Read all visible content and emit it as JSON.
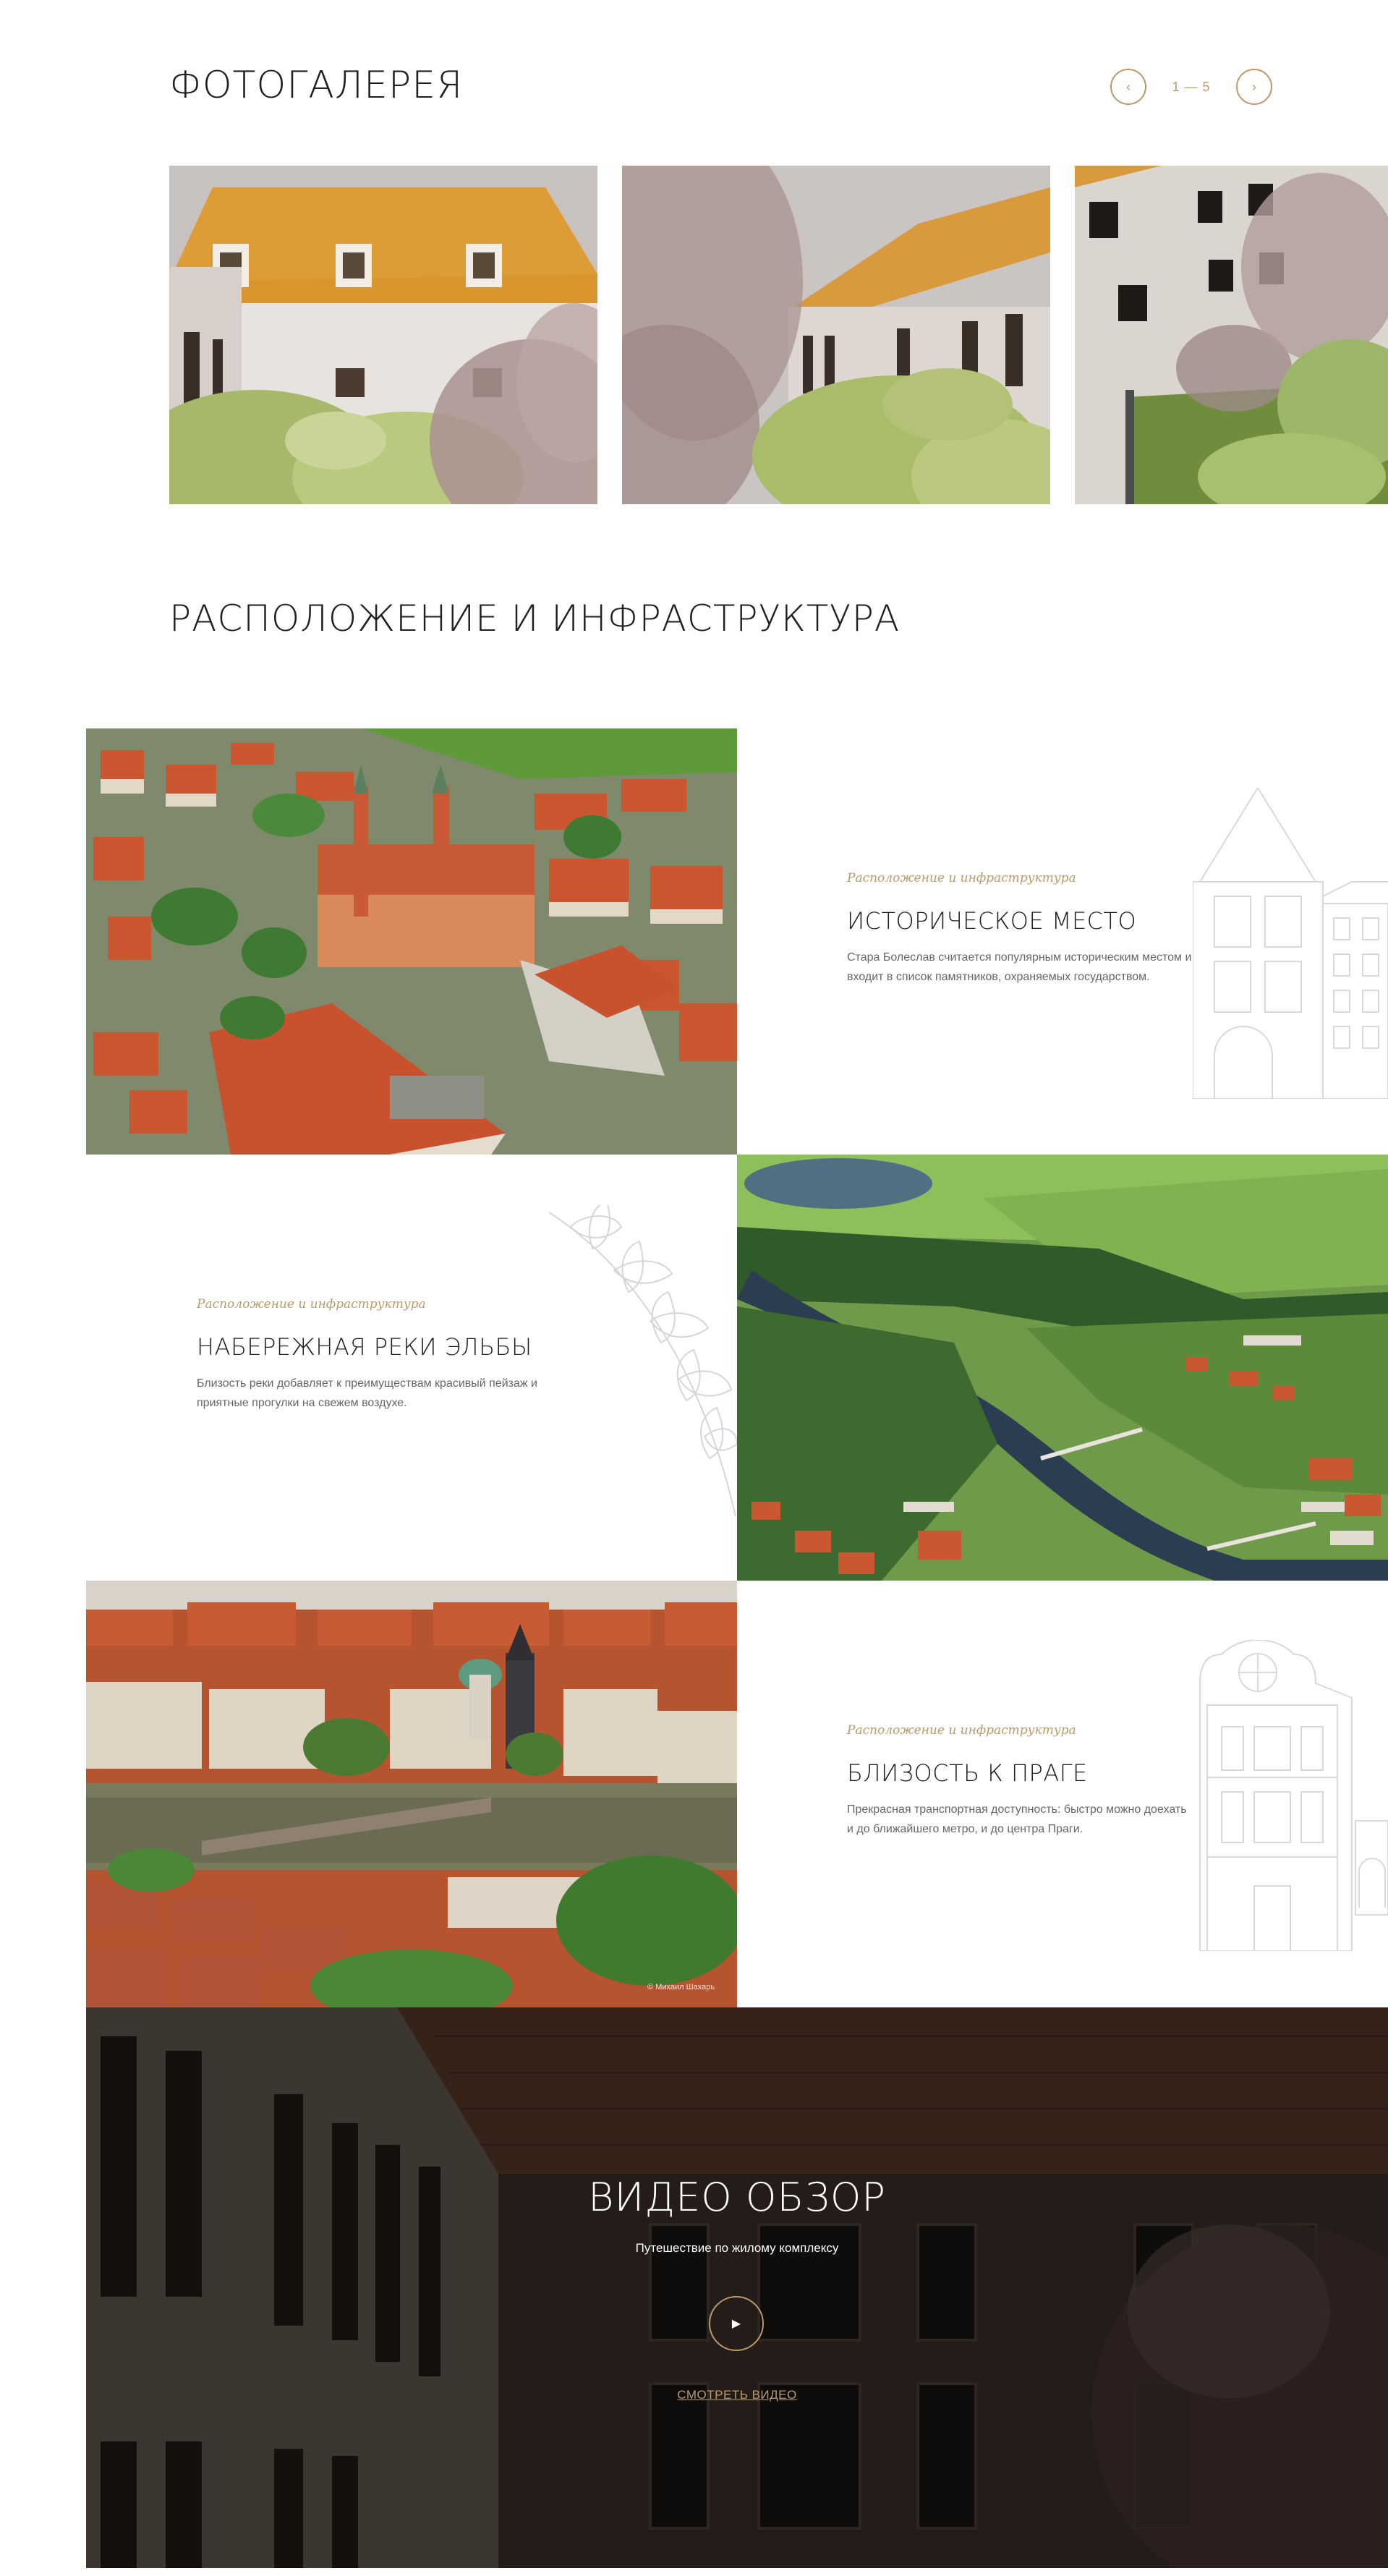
{
  "gallery": {
    "title": "ФОТОГАЛЕРЕЯ",
    "pager_prev_icon": "‹",
    "pager_next_icon": "›",
    "pager_count": "1 — 5"
  },
  "location": {
    "title": "РАСПОЛОЖЕНИЕ И ИНФРАСТРУКТУРА",
    "cards": [
      {
        "kicker": "Расположение и инфраструктура",
        "title": "ИСТОРИЧЕСКОЕ МЕСТО",
        "text_line1": "Стара Болеслав считается популярным историческим местом и",
        "text_line2": "входит в список памятников, охраняемых государством."
      },
      {
        "kicker": "Расположение и инфраструктура",
        "title": "НАБЕРЕЖНАЯ РЕКИ ЭЛЬБЫ",
        "text_line1": "Близость реки добавляет к преимуществам красивый пейзаж и",
        "text_line2": "приятные прогулки на свежем воздухе."
      },
      {
        "kicker": "Расположение и инфраструктура",
        "title": "БЛИЗОСТЬ К ПРАГЕ",
        "text_line1": "Прекрасная транспортная доступность: быстро можно доехать",
        "text_line2": "и до ближайшего метро, и до центра Праги."
      }
    ],
    "photo_credit": "© Михаил Шахарь"
  },
  "video": {
    "title": "ВИДЕО ОБЗОР",
    "subtitle": "Путешествие по жилому комплексу",
    "play_icon": "▶",
    "link_label": "СМОТРЕТЬ ВИДЕО"
  },
  "colors": {
    "accent": "#b99a6a",
    "heading": "#1f1f1f",
    "body_text": "#666666"
  }
}
